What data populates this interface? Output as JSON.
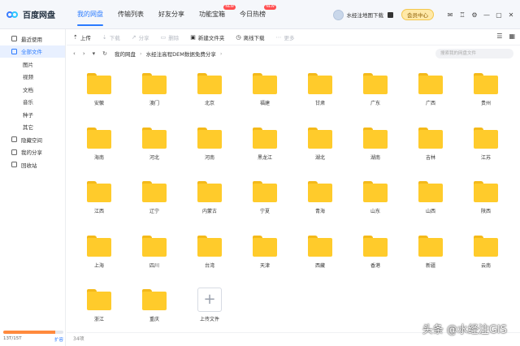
{
  "app": {
    "logo_text": "百度网盘"
  },
  "nav": [
    {
      "label": "我的网盘",
      "active": true,
      "badge": ""
    },
    {
      "label": "传输列表",
      "active": false,
      "badge": ""
    },
    {
      "label": "好友分享",
      "active": false,
      "badge": ""
    },
    {
      "label": "功能宝箱",
      "active": false,
      "badge": "NEW"
    },
    {
      "label": "今日热榜",
      "active": false,
      "badge": "NEW"
    }
  ],
  "user": {
    "name": "水经注地图下载",
    "member_button": "会员中心"
  },
  "sidebar": {
    "items": [
      {
        "label": "最近使用",
        "icon": "clock-icon",
        "sub": false,
        "active": false
      },
      {
        "label": "全部文件",
        "icon": "file-icon",
        "sub": false,
        "active": true
      },
      {
        "label": "图片",
        "icon": "",
        "sub": true,
        "active": false
      },
      {
        "label": "视频",
        "icon": "",
        "sub": true,
        "active": false
      },
      {
        "label": "文档",
        "icon": "",
        "sub": true,
        "active": false
      },
      {
        "label": "音乐",
        "icon": "",
        "sub": true,
        "active": false
      },
      {
        "label": "种子",
        "icon": "",
        "sub": true,
        "active": false
      },
      {
        "label": "其它",
        "icon": "",
        "sub": true,
        "active": false
      },
      {
        "label": "隐藏空间",
        "icon": "lock-icon",
        "sub": false,
        "active": false
      },
      {
        "label": "我的分享",
        "icon": "share-icon",
        "sub": false,
        "active": false
      },
      {
        "label": "回收站",
        "icon": "trash-icon",
        "sub": false,
        "active": false
      }
    ],
    "storage": {
      "text": "13T/15T",
      "expand": "扩容",
      "fraction": 0.867
    }
  },
  "toolbar": {
    "buttons": [
      {
        "label": "上传",
        "glyph": "⇡",
        "disabled": false
      },
      {
        "label": "下载",
        "glyph": "⇣",
        "disabled": true
      },
      {
        "label": "分享",
        "glyph": "↗",
        "disabled": true
      },
      {
        "label": "删除",
        "glyph": "▭",
        "disabled": true
      },
      {
        "label": "新建文件夹",
        "glyph": "▣",
        "disabled": false
      },
      {
        "label": "离线下载",
        "glyph": "◷",
        "disabled": false
      },
      {
        "label": "更多",
        "glyph": "⋯",
        "disabled": true
      }
    ]
  },
  "path": {
    "root": "我的网盘",
    "current": "水经注高程DEM数据免费分享",
    "search_placeholder": "搜索我的网盘文件"
  },
  "folders": [
    "安徽",
    "澳门",
    "北京",
    "福建",
    "甘肃",
    "广东",
    "广西",
    "贵州",
    "海南",
    "河北",
    "河南",
    "黑龙江",
    "湖北",
    "湖南",
    "吉林",
    "江苏",
    "江西",
    "辽宁",
    "内蒙古",
    "宁夏",
    "青海",
    "山东",
    "山西",
    "陕西",
    "上海",
    "四川",
    "台湾",
    "天津",
    "西藏",
    "香港",
    "新疆",
    "云南",
    "浙江",
    "重庆"
  ],
  "upload_label": "上传文件",
  "footer": {
    "count": "34项"
  },
  "watermark": "头条 @水经注GIS"
}
